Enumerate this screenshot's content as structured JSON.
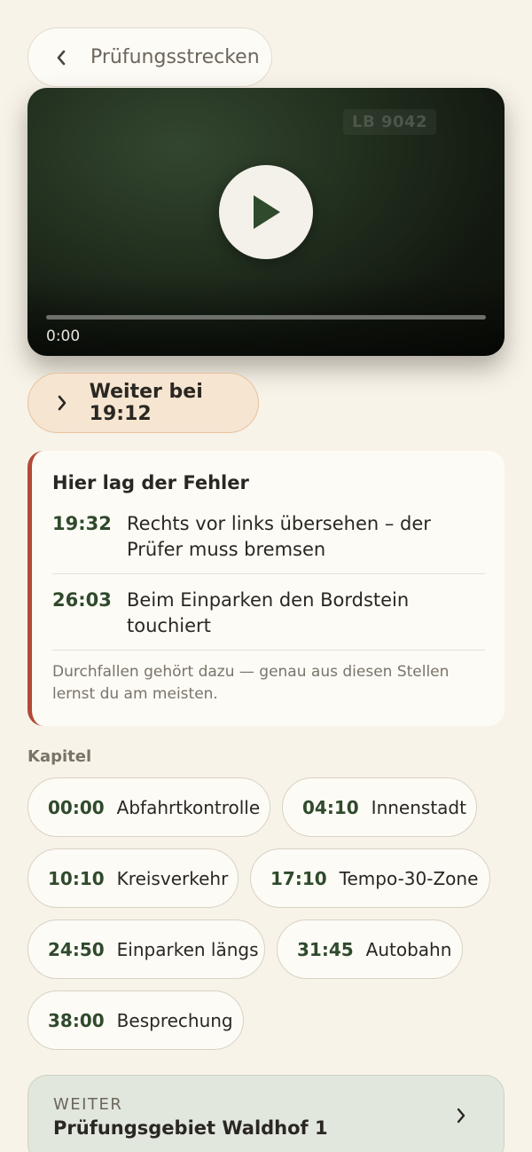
{
  "back": {
    "label": "Prüfungsstrecken"
  },
  "video": {
    "plate": "LB 9042",
    "time": "0:00",
    "progress": 0
  },
  "resume": {
    "label": "Weiter bei 19:12"
  },
  "errors": {
    "title": "Hier lag der Fehler",
    "items": [
      {
        "time": "19:32",
        "text": "Rechts vor links übersehen – der Prüfer muss bremsen"
      },
      {
        "time": "26:03",
        "text": "Beim Einparken den Bordstein touchiert"
      }
    ],
    "note": "Durchfallen gehört dazu — genau aus diesen Stellen lernst du am meisten.",
    "accent": "#b24a37"
  },
  "chapters": {
    "label": "Kapitel",
    "items": [
      {
        "time": "00:00",
        "label": "Abfahrtkontrolle"
      },
      {
        "time": "04:10",
        "label": "Innenstadt"
      },
      {
        "time": "10:10",
        "label": "Kreisverkehr"
      },
      {
        "time": "17:10",
        "label": "Tempo-30-Zone"
      },
      {
        "time": "24:50",
        "label": "Einparken längs"
      },
      {
        "time": "31:45",
        "label": "Autobahn"
      },
      {
        "time": "38:00",
        "label": "Besprechung"
      }
    ]
  },
  "next": {
    "eyebrow": "WEITER",
    "title": "Prüfungsgebiet Waldhof 1"
  },
  "icons": {
    "back": "chevron-left-icon",
    "play": "play-icon",
    "resume": "chevron-right-icon",
    "next": "chevron-right-icon"
  },
  "colors": {
    "background": "#f8f3e9",
    "accent_green": "#2f4a2c",
    "error_red": "#b24a37",
    "resume_bg": "#f6e5d1"
  }
}
